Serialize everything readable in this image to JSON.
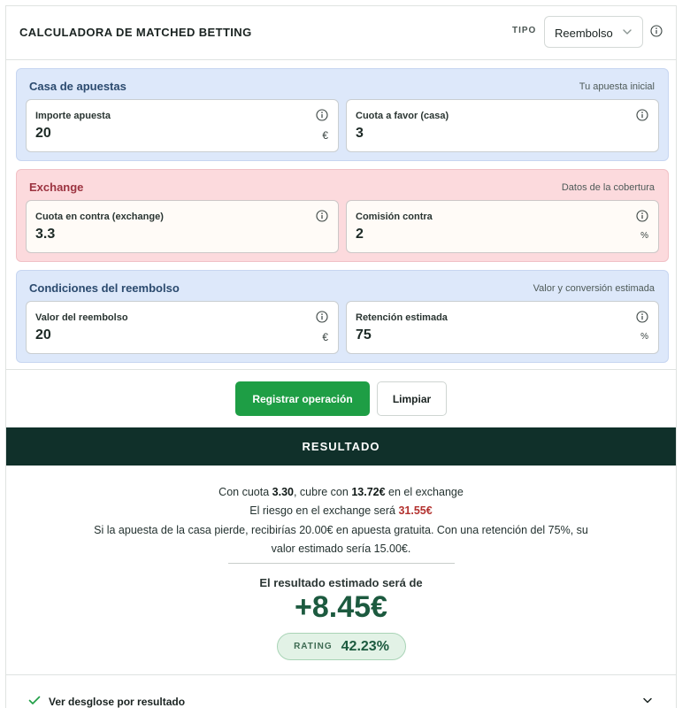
{
  "header": {
    "title": "CALCULADORA DE MATCHED BETTING",
    "tipo_label": "TIPO",
    "tipo_value": "Reembolso"
  },
  "sections": {
    "casa": {
      "title": "Casa de apuestas",
      "note": "Tu apuesta inicial",
      "fields": [
        {
          "label": "Importe apuesta",
          "value": "20",
          "unit": "€"
        },
        {
          "label": "Cuota a favor (casa)",
          "value": "3",
          "unit": ""
        }
      ]
    },
    "exchange": {
      "title": "Exchange",
      "note": "Datos de la cobertura",
      "fields": [
        {
          "label": "Cuota en contra (exchange)",
          "value": "3.3",
          "unit": ""
        },
        {
          "label": "Comisión contra",
          "value": "2",
          "unit": "%"
        }
      ]
    },
    "reembolso": {
      "title": "Condiciones del reembolso",
      "note": "Valor y conversión estimada",
      "fields": [
        {
          "label": "Valor del reembolso",
          "value": "20",
          "unit": "€"
        },
        {
          "label": "Retención estimada",
          "value": "75",
          "unit": "%"
        }
      ]
    }
  },
  "actions": {
    "register": "Registrar operación",
    "clear": "Limpiar"
  },
  "result": {
    "band_title": "RESULTADO",
    "line1": {
      "pre": "Con cuota ",
      "odds": "3.30",
      "mid": ", cubre con ",
      "stake": "13.72€",
      "post": " en el exchange"
    },
    "line2": {
      "pre": "El riesgo en el exchange será ",
      "risk": "31.55€"
    },
    "line3": "Si la apuesta de la casa pierde, recibirías 20.00€ en apuesta gratuita. Con una retención del 75%, su",
    "line4": "valor estimado sería 15.00€.",
    "estimated_label": "El resultado estimado será de",
    "estimated_value": "+8.45€",
    "rating_label": "RATING",
    "rating_value": "42.23%"
  },
  "desglose": {
    "label": "Ver desglose por resultado"
  },
  "colors": {
    "primary_green": "#1e9e45",
    "result_band": "#10302a",
    "risk_red": "#b3322f",
    "blue_section": "#dde8fa",
    "red_section": "#fcdadd"
  }
}
